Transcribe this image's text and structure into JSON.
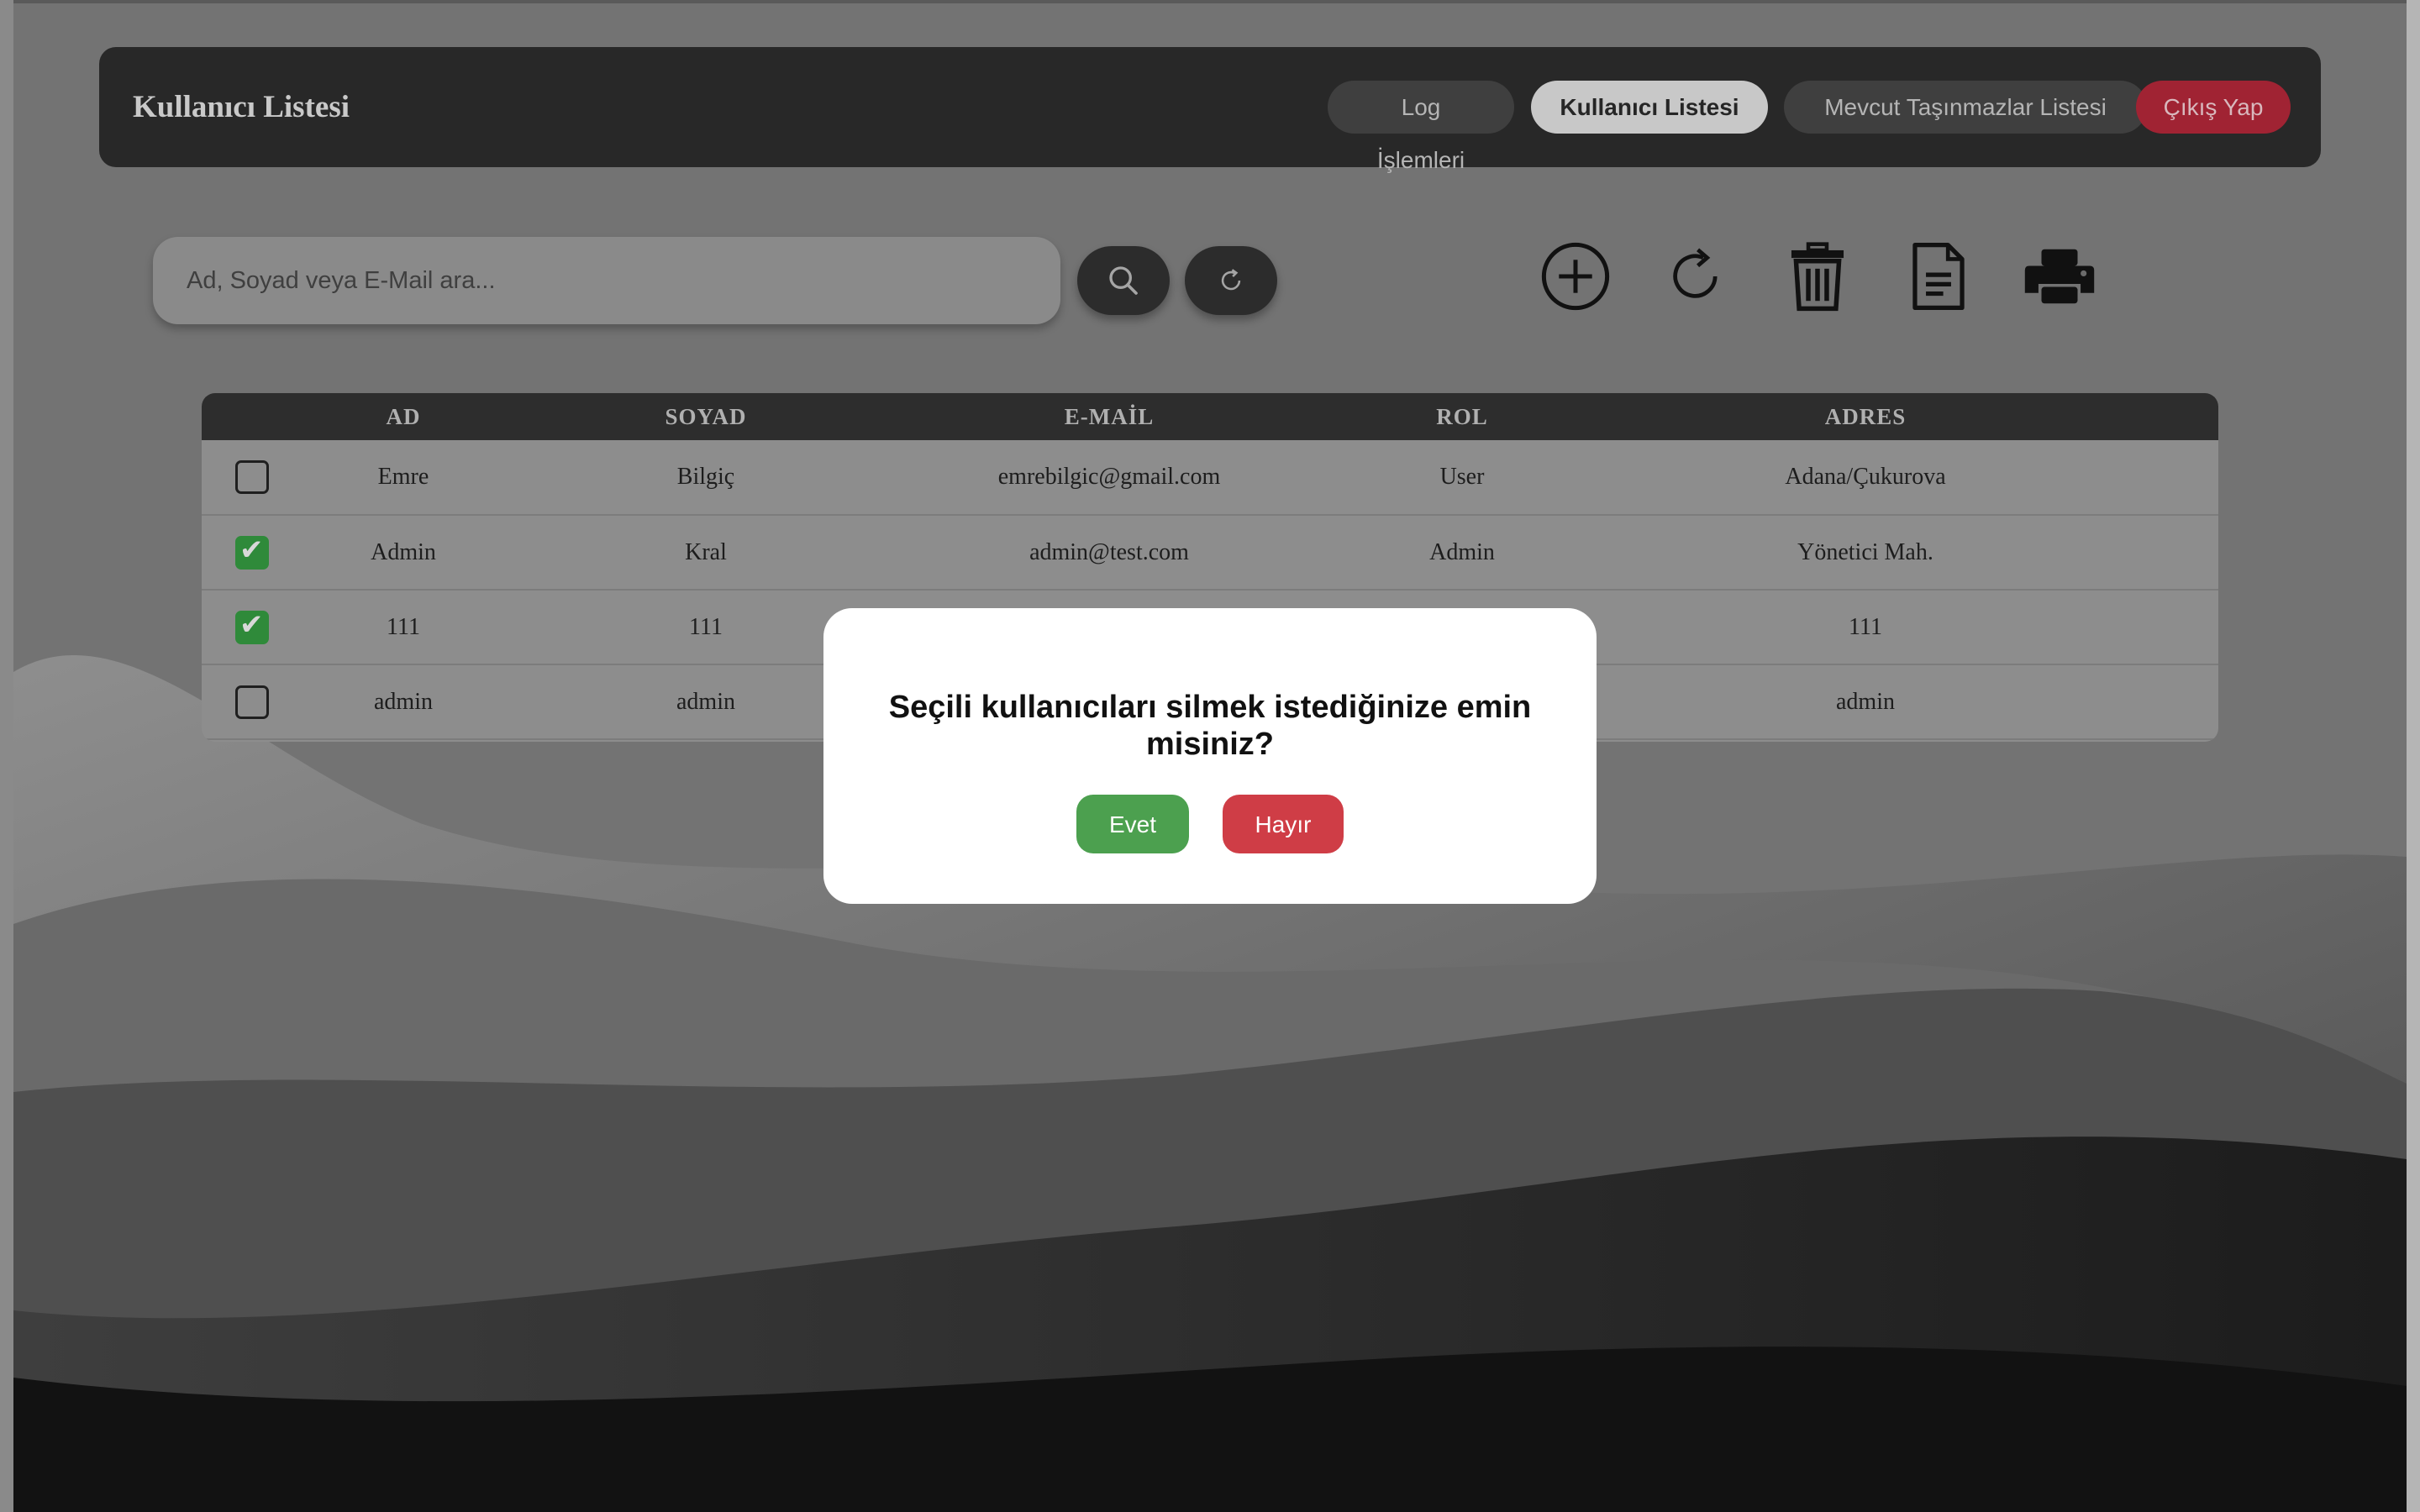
{
  "header": {
    "title": "Kullanıcı Listesi",
    "nav": {
      "logs": "Log İşlemleri",
      "users": "Kullanıcı Listesi",
      "properties": "Mevcut Taşınmazlar Listesi",
      "logout": "Çıkış Yap"
    }
  },
  "search": {
    "placeholder": "Ad, Soyad veya E-Mail ara...",
    "value": ""
  },
  "table": {
    "headers": {
      "ad": "AD",
      "soyad": "SOYAD",
      "email": "E-MAİL",
      "rol": "ROL",
      "adres": "ADRES"
    },
    "rows": [
      {
        "checked": false,
        "ad": "Emre",
        "soyad": "Bilgiç",
        "email": "emrebilgic@gmail.com",
        "rol": "User",
        "adres": "Adana/Çukurova"
      },
      {
        "checked": true,
        "ad": "Admin",
        "soyad": "Kral",
        "email": "admin@test.com",
        "rol": "Admin",
        "adres": "Yönetici Mah."
      },
      {
        "checked": true,
        "ad": "111",
        "soyad": "111",
        "email": "",
        "rol": "",
        "adres": "111"
      },
      {
        "checked": false,
        "ad": "admin",
        "soyad": "admin",
        "email": "",
        "rol": "",
        "adres": "admin"
      }
    ]
  },
  "modal": {
    "message": "Seçili kullanıcıları silmek istediğinize emin misiniz?",
    "yes": "Evet",
    "no": "Hayır"
  },
  "icons": {
    "search": "search-icon",
    "reset": "refresh-icon",
    "add": "add-circle-icon",
    "reload": "reload-icon",
    "delete": "trash-icon",
    "report": "document-icon",
    "print": "printer-icon"
  },
  "colors": {
    "header_bg": "#282828",
    "logout": "#a02333",
    "yes_button": "#4ca04f",
    "no_button": "#cf3d46",
    "checked": "#2f8a3a"
  }
}
